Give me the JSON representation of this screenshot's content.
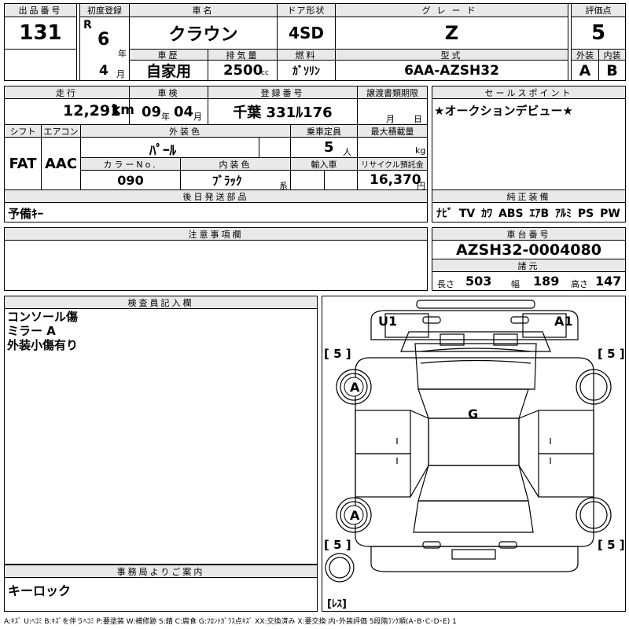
{
  "top": {
    "lot_no_label": "出品番号",
    "lot_no": "131",
    "first_reg_label": "初度登録",
    "era": "R",
    "year": "6",
    "year_unit": "年",
    "month": "4",
    "month_unit": "月",
    "car_name_label": "車名",
    "car_name": "クラウン",
    "door_label": "ドア形状",
    "door": "4SD",
    "grade_label": "グレード",
    "grade": "Z",
    "score_label": "評価点",
    "score": "5",
    "history_label": "車歴",
    "history": "自家用",
    "displacement_label": "排気量",
    "displacement": "2500",
    "displacement_unit": "cc",
    "fuel_label": "燃料",
    "fuel": "ｶﾞｿﾘﾝ",
    "model_label": "型式",
    "model": "6AA-AZSH32",
    "ext_label": "外装",
    "ext": "A",
    "int_label": "内装",
    "int": "B"
  },
  "mid": {
    "mileage_label": "走行",
    "mileage": "12,291",
    "mileage_unit": "km",
    "inspection_label": "車検",
    "insp_year": "09",
    "insp_year_unit": "年",
    "insp_month": "04",
    "insp_month_unit": "月",
    "plate_label": "登録番号",
    "plate": "千葉 331ﾙ176",
    "transfer_label": "譲渡書類期限",
    "transfer_month": "月",
    "transfer_day": "日",
    "shift_label": "シフト",
    "shift": "FAT",
    "ac_label": "エアコン",
    "ac": "AAC",
    "ext_color_label": "外装色",
    "ext_color": "ﾊﾟｰﾙ",
    "capacity_label": "乗車定員",
    "capacity": "5",
    "capacity_unit": "人",
    "load_label": "最大積載量",
    "load_unit": "kg",
    "color_no_label": "カラーNo.",
    "color_no": "090",
    "int_color_label": "内装色",
    "int_color": "ﾌﾞﾗｯｸ",
    "int_color_suffix": "系",
    "import_label": "輸入車",
    "recycle_label": "リサイクル預託金",
    "recycle": "16,370",
    "recycle_unit": "円",
    "later_label": "後日発送部品",
    "later": "予備ｷｰ",
    "sales_label": "セールスポイント",
    "sales": "★オークションデビュー★",
    "equip_label": "純正装備",
    "equip": "ﾅﾋﾞ TV ｶﾜ ABS ｴｱB ｱﾙﾐ PS PW"
  },
  "notes": {
    "label": "注意事項欄",
    "text": ""
  },
  "chassis": {
    "label": "車台番号",
    "value": "AZSH32-0004080",
    "spec_label": "諸元",
    "length_label": "長さ",
    "length": "503",
    "width_label": "幅",
    "width": "189",
    "height_label": "高さ",
    "height": "147"
  },
  "inspector": {
    "label": "検査員記入欄",
    "lines": [
      "コンソール傷",
      "ミラー A",
      "外装小傷有り"
    ]
  },
  "office": {
    "label": "事務局よりご案内",
    "text": "キーロック"
  },
  "diagram": {
    "u1": "U1",
    "a1": "A1",
    "g": "G",
    "a_front": "A",
    "a_rear": "A",
    "tl": "[ 5 ]",
    "tr": "[ 5 ]",
    "bl": "[ 5 ]",
    "br": "[ 5 ]",
    "spare": "[ﾚｽ]"
  },
  "legend": "A:ｷｽﾞ U:ﾍｺﾐ B:ｷｽﾞを伴うﾍｺﾐ P:要塗装 W:補修跡 S:錆 C:腐食 G:ﾌﾛﾝﾄｶﾞﾗｽ点ｷｽﾞ XX:交換済み X:要交換 内･外装評価 5段階ﾗﾝｸ順(A･B･C･D･E) 1"
}
